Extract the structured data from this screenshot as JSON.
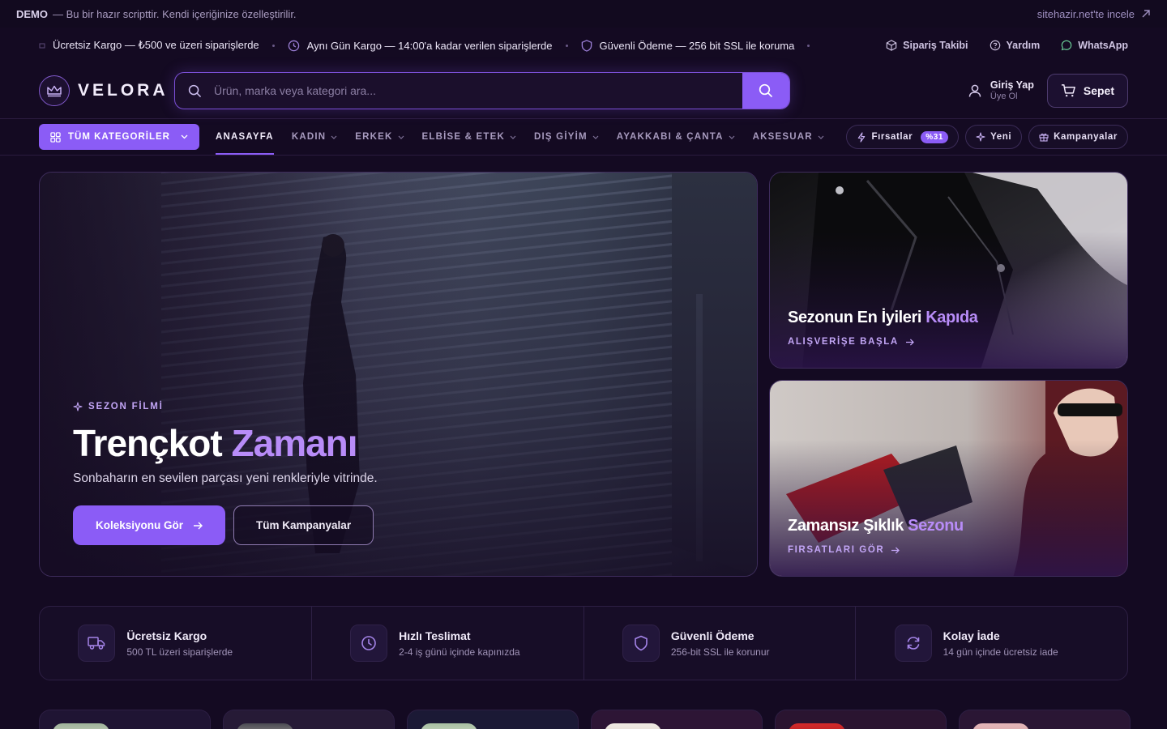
{
  "demo": {
    "label": "DEMO",
    "text": "— Bu bir hazır scripttir. Kendi içeriğinize özelleştirilir.",
    "link": "sitehazir.net'te incele"
  },
  "info": {
    "items": [
      "Ücretsiz Kargo — ₺500 ve üzeri siparişlerde",
      "Aynı Gün Kargo — 14:00'a kadar verilen siparişlerde",
      "Güvenli Ödeme — 256 bit SSL ile koruma"
    ],
    "links": [
      "Sipariş Takibi",
      "Yardım",
      "WhatsApp"
    ]
  },
  "header": {
    "logo": "VELORA",
    "search_placeholder": "Ürün, marka veya kategori ara...",
    "login": "Giriş Yap",
    "register": "Üye Ol",
    "cart": "Sepet"
  },
  "nav": {
    "all_categories": "TÜM KATEGORİLER",
    "items": [
      "ANASAYFA",
      "KADIN",
      "ERKEK",
      "ELBİSE & ETEK",
      "DIŞ GİYİM",
      "AYAKKABI & ÇANTA",
      "AKSESUAR"
    ],
    "deals": "Fırsatlar",
    "deals_badge": "%31",
    "new": "Yeni",
    "campaigns": "Kampanyalar"
  },
  "hero": {
    "eyebrow": "SEZON FİLMİ",
    "title": "Trençkot",
    "title_highlight": "Zamanı",
    "subtitle": "Sonbaharın en sevilen parçası yeni renkleriyle vitrinde.",
    "primary_button": "Koleksiyonu Gör",
    "secondary_button": "Tüm Kampanyalar"
  },
  "promos": [
    {
      "title": "Sezonun En İyileri",
      "highlight": "Kapıda",
      "link": "ALIŞVERİŞE BAŞLA"
    },
    {
      "title": "Zamansız Şıklık",
      "highlight": "Sezonu",
      "link": "FIRSATLARI GÖR"
    }
  ],
  "features": [
    {
      "title": "Ücretsiz Kargo",
      "subtitle": "500 TL üzeri siparişlerde",
      "icon": "truck-icon"
    },
    {
      "title": "Hızlı Teslimat",
      "subtitle": "2-4 iş günü içinde kapınızda",
      "icon": "clock-icon"
    },
    {
      "title": "Güvenli Ödeme",
      "subtitle": "256-bit SSL ile korunur",
      "icon": "shield-icon"
    },
    {
      "title": "Kolay İade",
      "subtitle": "14 gün içinde ücretsiz iade",
      "icon": "refresh-icon"
    }
  ],
  "colors": {
    "accent": "#8b5cf6",
    "highlight": "#b88cf8",
    "background": "#140a22"
  }
}
